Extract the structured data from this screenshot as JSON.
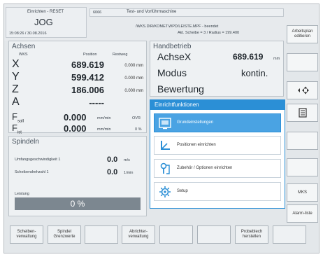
{
  "header": {
    "mode_title": "Einrichten - RESET",
    "mode": "JOG",
    "datetime": "15:08:26 / 30.08.2016",
    "code": "6066",
    "machine": "Test- und Vorführmaschine",
    "program_status": "/WKS.DIR/KOMET.WPD/LEISTE.MPF - beendet",
    "scheibe": "Akt. Scheibe = 3  /  Radius = 199.400"
  },
  "achsen": {
    "title": "Achsen",
    "col_wks": "WKS",
    "col_position": "Position",
    "col_restweg": "Restweg",
    "axes": [
      {
        "name": "X",
        "position": "689.619",
        "restweg": "0.000 mm"
      },
      {
        "name": "Y",
        "position": "599.412",
        "restweg": "0.000 mm"
      },
      {
        "name": "Z",
        "position": "186.006",
        "restweg": "0.000 mm"
      },
      {
        "name": "A",
        "position": "-----",
        "restweg": ""
      }
    ],
    "f_soll_label": "F",
    "f_soll_sub": "soll",
    "f_soll_value": "0.000",
    "f_soll_unit": "mm/min",
    "ovr_label": "OVR",
    "f_ist_label": "F",
    "f_ist_sub": "ist",
    "f_ist_value": "0.000",
    "f_ist_unit": "mm/min",
    "ovr_value": "0 %"
  },
  "handbetrieb": {
    "title": "Handbetrieb",
    "axis_label": "AchseX",
    "axis_value": "689.619",
    "axis_unit": "mm",
    "modus_label": "Modus",
    "modus_value": "kontin.",
    "bewertung_label": "Bewertung"
  },
  "spindeln": {
    "title": "Spindeln",
    "row1_label": "Umfangsgeschwindigkeit 1",
    "row1_value": "0.0",
    "row1_unit": "m/s",
    "row2_label": "Scheibendrehzahl 1",
    "row2_value": "0.0",
    "row2_unit": "1/min",
    "leistung_label": "Leistung",
    "leistung_value": "0 %",
    "leistung_fraction": 0
  },
  "einrichtfunktionen": {
    "title": "Einrichtfunktionen",
    "items": [
      {
        "label": "Grundeinstellungen",
        "icon": "settings-screen-icon",
        "active": true
      },
      {
        "label": "Positionen einrichten",
        "icon": "positions-icon",
        "active": false
      },
      {
        "label": "Zubehör / Optionen einrichten",
        "icon": "accessory-icon",
        "active": false
      },
      {
        "label": "Setup",
        "icon": "gear-icon",
        "active": false
      }
    ]
  },
  "side_buttons": {
    "arbeitsplan": "Arbeitsplan editieren",
    "mks": "MKS",
    "alarm": "Alarm-liste"
  },
  "bottom_buttons": {
    "scheiben": "Scheiben-verwaltung",
    "spindel": "Spindel Grenzwerte",
    "abrichter": "Abrichter-verwaltung",
    "probeblech": "Probeblech herstellen"
  },
  "colors": {
    "accent": "#2b8fd6",
    "highlight": "#4aa3e3",
    "progress_bg": "#7c8790"
  }
}
